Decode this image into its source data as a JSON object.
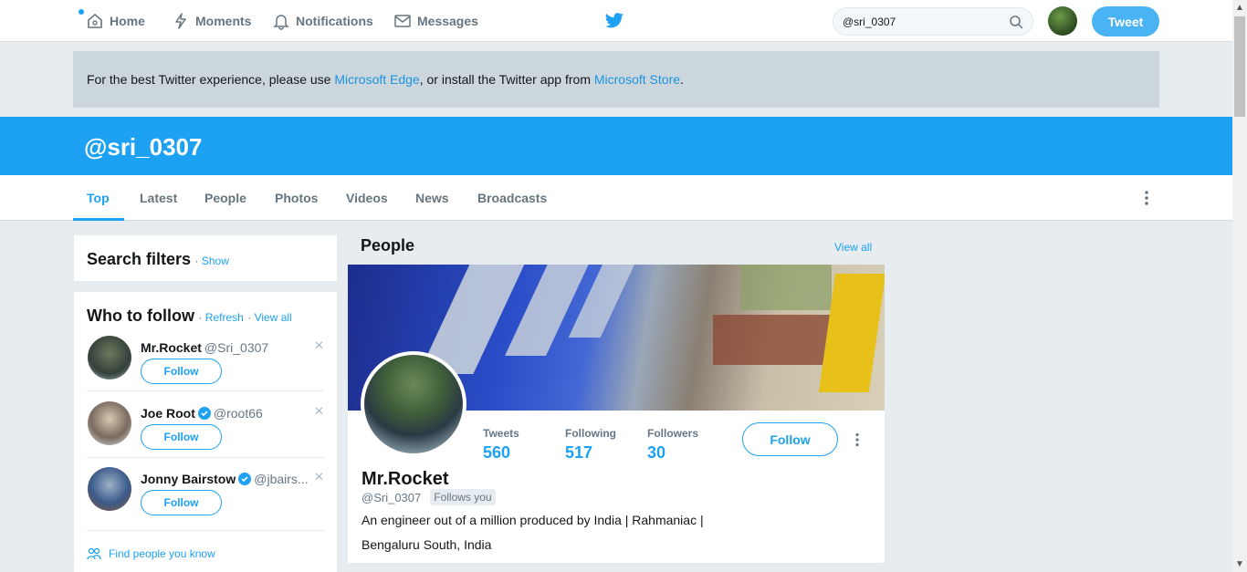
{
  "nav": {
    "home": "Home",
    "moments": "Moments",
    "notifications": "Notifications",
    "messages": "Messages",
    "search_value": "@sri_0307",
    "tweet_button": "Tweet"
  },
  "banner": {
    "text_before": "For the best Twitter experience, please use ",
    "link1": "Microsoft Edge",
    "text_middle": ", or install the Twitter app from ",
    "link2": "Microsoft Store",
    "text_after": "."
  },
  "header": {
    "title": "@sri_0307"
  },
  "tabs": [
    "Top",
    "Latest",
    "People",
    "Photos",
    "Videos",
    "News",
    "Broadcasts"
  ],
  "search_filters": {
    "title": "Search filters",
    "show": "Show"
  },
  "who_to_follow": {
    "title": "Who to follow",
    "refresh": "Refresh",
    "view_all": "View all",
    "people": [
      {
        "name": "Mr.Rocket",
        "handle": "@Sri_0307",
        "follow": "Follow",
        "verified": false
      },
      {
        "name": "Joe Root",
        "handle": "@root66",
        "follow": "Follow",
        "verified": true
      },
      {
        "name": "Jonny Bairstow",
        "handle": "@jbairs...",
        "follow": "Follow",
        "verified": true
      }
    ],
    "find_people": "Find people you know"
  },
  "people_section": {
    "title": "People",
    "view_all": "View all",
    "profile": {
      "stats": [
        {
          "label": "Tweets",
          "value": "560"
        },
        {
          "label": "Following",
          "value": "517"
        },
        {
          "label": "Followers",
          "value": "30"
        }
      ],
      "follow": "Follow",
      "name": "Mr.Rocket",
      "handle": "@Sri_0307",
      "follows_you": "Follows you",
      "bio": "An engineer out of a million produced by India | Rahmaniac |",
      "location": "Bengaluru South, India"
    }
  },
  "colors": {
    "brand": "#1da1f2",
    "background": "#e6ecf0"
  }
}
